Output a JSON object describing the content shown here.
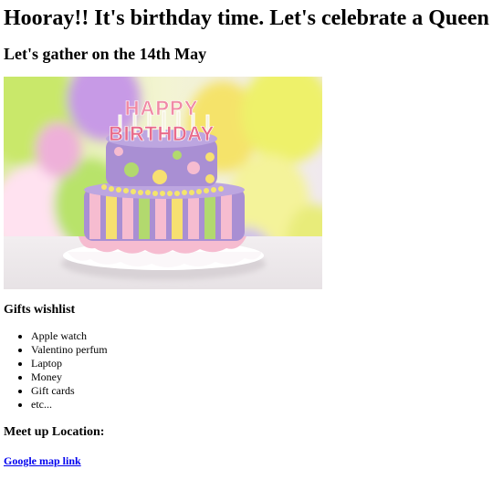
{
  "header": {
    "title": "Hooray!! It's birthday time. Let's celebrate a Queen",
    "subtitle": "Let's gather on the 14th May"
  },
  "photo": {
    "cake_text_top": "HAPPY",
    "cake_text_bottom": "BIRTHDAY",
    "colors": {
      "cake_purple": "#a98fd3",
      "icing_pink": "#f6bcd0",
      "balloon_yellow": "#eef16a",
      "balloon_purple": "#c79ae6"
    }
  },
  "wishlist": {
    "title": "Gifts wishlist",
    "items": [
      "Apple watch",
      "Valentino perfum",
      "Laptop",
      "Money",
      "Gift cards",
      "etc..."
    ]
  },
  "meetup": {
    "title": "Meet up Location:",
    "link_label": "Google map link"
  }
}
